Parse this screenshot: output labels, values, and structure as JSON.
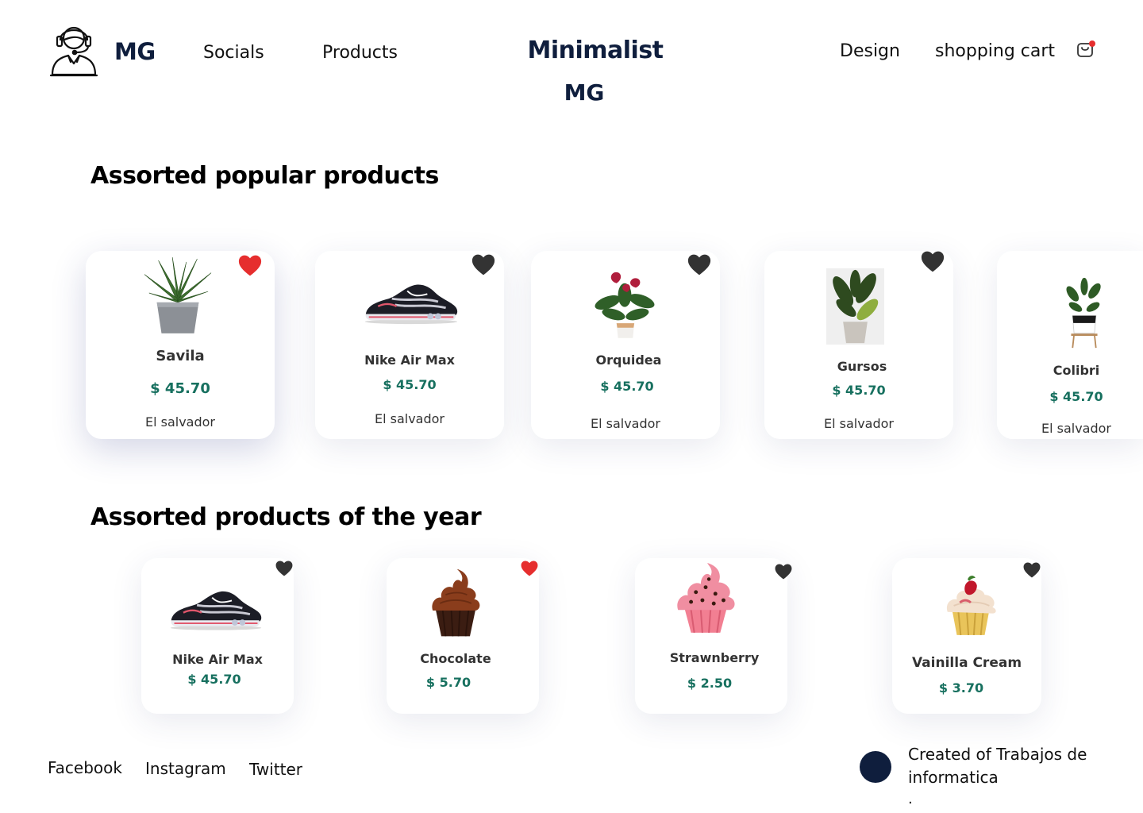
{
  "header": {
    "brand": "MG",
    "nav": [
      "Socials",
      "Products"
    ],
    "center_title": "Minimalist",
    "center_subtitle": "MG",
    "right_nav": [
      "Design",
      "shopping cart"
    ]
  },
  "colors": {
    "accent_dark": "#0f1e3d",
    "price_green": "#17705f",
    "fav_active": "#e62e2e",
    "fav_inactive": "#333333"
  },
  "popular": {
    "title": "Assorted popular products",
    "items": [
      {
        "name": "Savila",
        "price": "$ 45.70",
        "location": "El salvador",
        "favorite": true,
        "icon": "aloe-plant"
      },
      {
        "name": "Nike Air Max",
        "price": "$ 45.70",
        "location": "El salvador",
        "favorite": false,
        "icon": "sneaker"
      },
      {
        "name": "Orquidea",
        "price": "$ 45.70",
        "location": "El salvador",
        "favorite": false,
        "icon": "anthurium-plant"
      },
      {
        "name": "Gursos",
        "price": "$ 45.70",
        "location": "El salvador",
        "favorite": false,
        "icon": "ficus-plant"
      },
      {
        "name": "Colibri",
        "price": "$ 45.70",
        "location": "El salvador",
        "favorite": false,
        "icon": "zz-plant"
      }
    ]
  },
  "year": {
    "title": "Assorted products of the year",
    "items": [
      {
        "name": "Nike Air Max",
        "price": "$ 45.70",
        "favorite": false,
        "icon": "sneaker"
      },
      {
        "name": "Chocolate",
        "price": "$ 5.70",
        "favorite": true,
        "icon": "chocolate-cupcake"
      },
      {
        "name": "Strawnberry",
        "price": "$ 2.50",
        "favorite": false,
        "icon": "strawberry-cupcake"
      },
      {
        "name": "Vainilla Cream",
        "price": "$ 3.70",
        "favorite": false,
        "icon": "vanilla-cupcake"
      }
    ]
  },
  "footer": {
    "socials": [
      "Facebook",
      "Instagram",
      "Twitter"
    ],
    "credit": "Created of Trabajos de informatica",
    "dot": "."
  }
}
